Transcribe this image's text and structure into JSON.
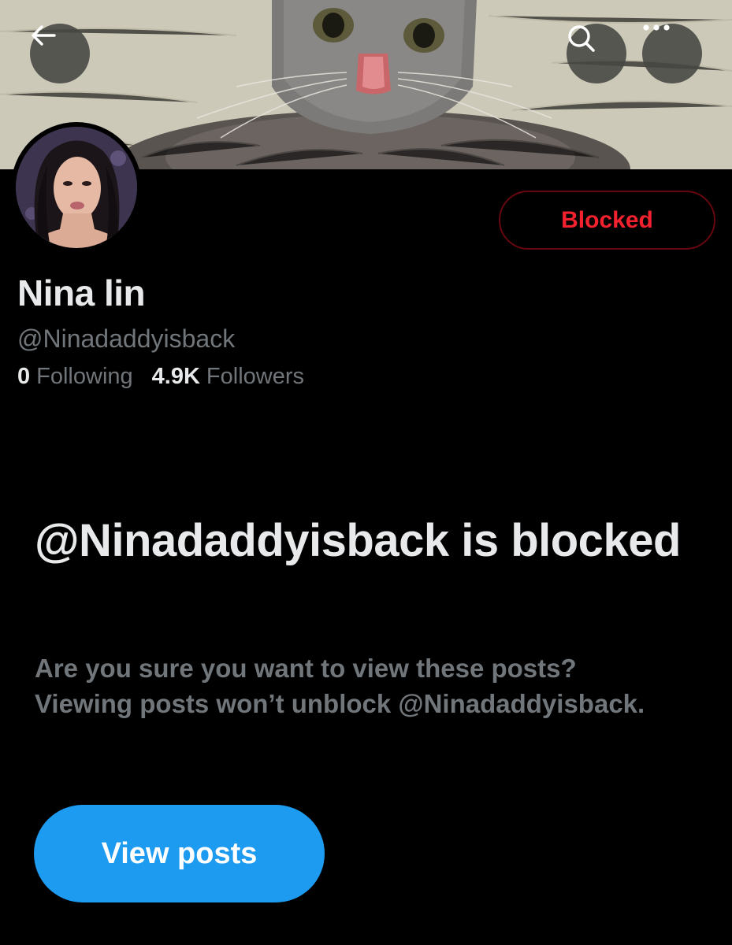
{
  "banner": {
    "image": "cat-photo-banner"
  },
  "top_bar": {
    "back_icon": "arrow-left-icon",
    "search_icon": "search-icon",
    "more_icon": "more-dots-icon"
  },
  "profile": {
    "avatar": "profile-photo",
    "display_name": "Nina lin",
    "handle": "@Ninadaddyisback",
    "following_count": "0",
    "following_label": "Following",
    "followers_count": "4.9K",
    "followers_label": "Followers",
    "blocked_label": "Blocked"
  },
  "notice": {
    "title": "@Ninadaddyisback is blocked",
    "body": "Are you sure you want to view these posts? Viewing posts won’t unblock @Ninadaddyisback.",
    "button_label": "View posts"
  },
  "colors": {
    "background": "#000000",
    "text_primary": "#e7e9ea",
    "text_secondary": "#71767b",
    "blocked_red": "#f4212e",
    "accent_blue": "#1d9bf0"
  }
}
